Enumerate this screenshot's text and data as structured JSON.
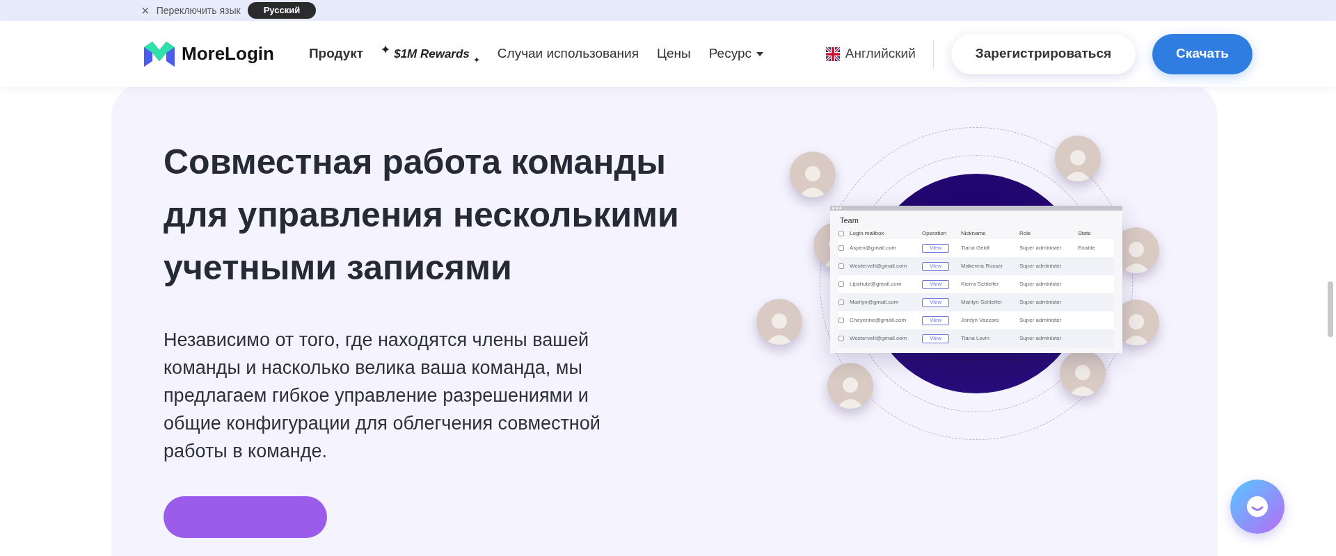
{
  "language_bar": {
    "close": "×",
    "label": "Переключить язык",
    "language": "Русский"
  },
  "navbar": {
    "logo": "MoreLogin",
    "items": [
      {
        "kind": "bold",
        "label": "Продукт"
      },
      {
        "kind": "rewards",
        "label": "$1M Rewards"
      },
      {
        "kind": "plain",
        "label": "Случаи использования"
      },
      {
        "kind": "plain",
        "label": "Цены"
      },
      {
        "kind": "dropdown",
        "label": "Ресурс"
      }
    ],
    "language": "Английский",
    "register": "Зарегистрироваться",
    "download": "Скачать"
  },
  "hero": {
    "title": "Совместная работа команды для управления несколькими учетными записями",
    "description": "Независимо от того, где находятся члены вашей команды и насколько велика ваша команда, мы предлагаем гибкое управление разрешениями и общие конфигурации для облегчения совместной работы в команде."
  },
  "team_window": {
    "title": "Team",
    "all_checked": false,
    "columns": [
      "Login mailbox",
      "Operation",
      "Nickname",
      "Role",
      "State"
    ],
    "rows": [
      {
        "checked": false,
        "email": "Aspen@gmail.com",
        "action": "View",
        "nickname": "Tiana Geidt",
        "role": "Super administer",
        "state": "Enable"
      },
      {
        "checked": false,
        "email": "Westervelt@gmail.com",
        "action": "View",
        "nickname": "Makenna Rosser",
        "role": "Super administer"
      },
      {
        "checked": false,
        "email": "Lipshutz@gmail.com",
        "action": "View",
        "nickname": "Kierra Schleifer",
        "role": "Super administer"
      },
      {
        "checked": false,
        "email": "Marilyn@gmail.com",
        "action": "View",
        "nickname": "Marilyn Schleifer",
        "role": "Super administer"
      },
      {
        "checked": false,
        "email": "Cheyenne@gmail.com",
        "action": "View",
        "nickname": "Jordyn Vaccaro",
        "role": "Super administer"
      },
      {
        "checked": false,
        "email": "Westervelt@gmail.com",
        "action": "View",
        "nickname": "Tiana Levin",
        "role": "Super administer"
      }
    ]
  }
}
